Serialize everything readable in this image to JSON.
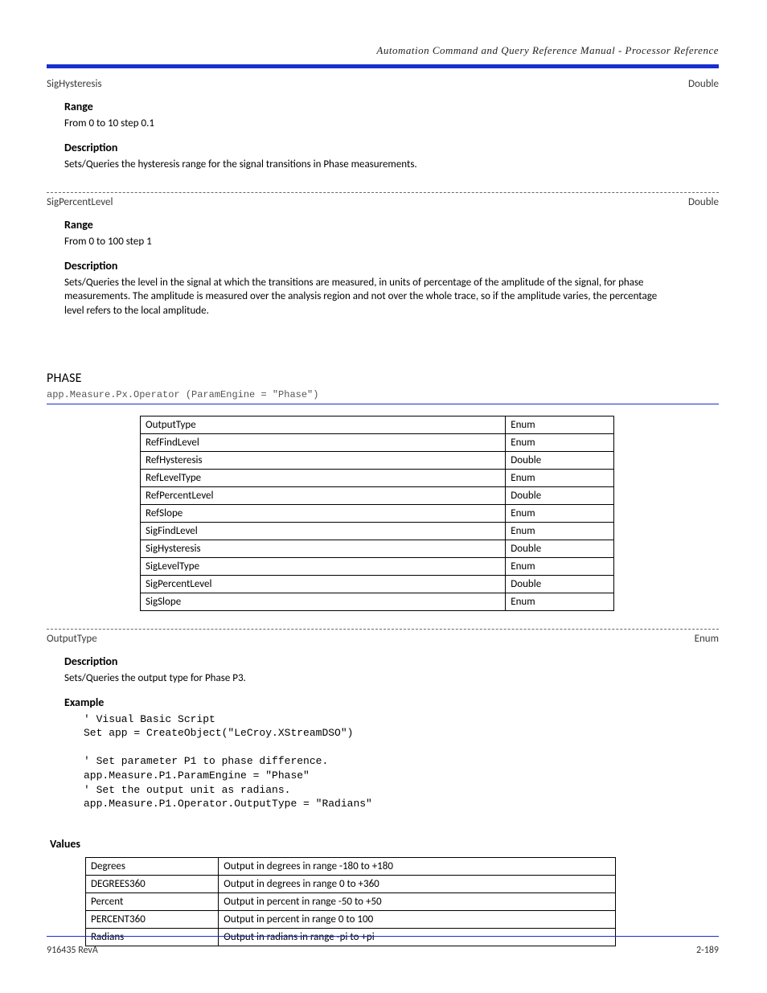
{
  "header": {
    "doc_title": "Automation Command and Query Reference Manual - Processor Reference"
  },
  "prop1": {
    "name": "SigHysteresis",
    "type": "Double",
    "range": "From 0 to 10 step 0.1",
    "description": "Sets/Queries the hysteresis range for the signal transitions in Phase measurements."
  },
  "prop2": {
    "name": "SigPercentLevel",
    "type": "Double",
    "range": "From 0 to 100 step 1",
    "description": "Sets/Queries the level in the signal at which the transitions are measured, in units of percentage of the amplitude of the signal, for phase measurements. The amplitude is  measured over the analysis region and not over the whole trace, so if the amplitude varies, the percentage level refers to the local amplitude."
  },
  "section": {
    "title": "PHASE",
    "path": "app.Measure.Px.Operator (ParamEngine = \"Phase\")"
  },
  "cvars": [
    {
      "name": "OutputType",
      "type": "Enum"
    },
    {
      "name": "RefFindLevel",
      "type": "Enum"
    },
    {
      "name": "RefHysteresis",
      "type": "Double"
    },
    {
      "name": "RefLevelType",
      "type": "Enum"
    },
    {
      "name": "RefPercentLevel",
      "type": "Double"
    },
    {
      "name": "RefSlope",
      "type": "Enum"
    },
    {
      "name": "SigFindLevel",
      "type": "Enum"
    },
    {
      "name": "SigHysteresis",
      "type": "Double"
    },
    {
      "name": "SigLevelType",
      "type": "Enum"
    },
    {
      "name": "SigPercentLevel",
      "type": "Double"
    },
    {
      "name": "SigSlope",
      "type": "Enum"
    }
  ],
  "cvar_detail": {
    "name": "OutputType",
    "type": "Enum",
    "description": "Sets/Queries the output type for Phase P3.",
    "example_label": "Example",
    "code": "' Visual Basic Script\nSet app = CreateObject(\"LeCroy.XStreamDSO\")\n\n' Set parameter P1 to phase difference.\napp.Measure.P1.ParamEngine = \"Phase\"\n' Set the output unit as radians.\napp.Measure.P1.Operator.OutputType = \"Radians\"",
    "values_label": "Values",
    "values": [
      {
        "k": "Degrees",
        "v": "Output in degrees in range -180 to +180"
      },
      {
        "k": "DEGREES360",
        "v": "Output in degrees in range 0 to +360"
      },
      {
        "k": "Percent",
        "v": "Output in percent in range -50 to +50"
      },
      {
        "k": "PERCENT360",
        "v": "Output in percent in range 0 to 100"
      },
      {
        "k": "Radians",
        "v": "Output in radians in range -pi to +pi"
      }
    ]
  },
  "footer": {
    "rev": "916435 RevA",
    "page": "2-189"
  }
}
